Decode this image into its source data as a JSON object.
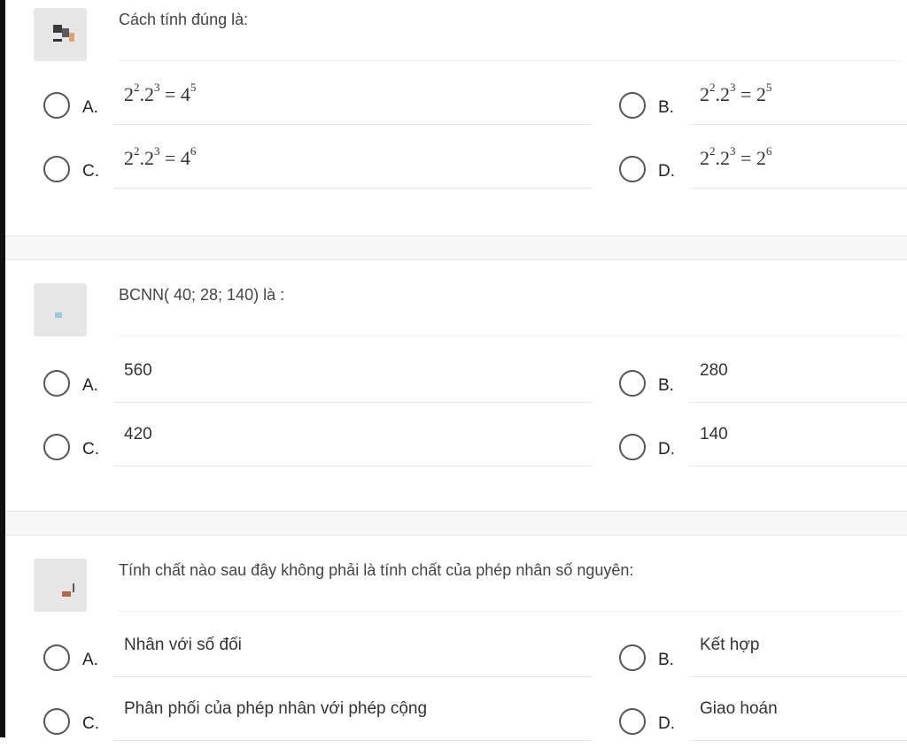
{
  "questions": [
    {
      "text": "Cách tính đúng là:",
      "options": [
        {
          "letter": "A.",
          "math": [
            {
              "b": "2",
              "e": "2"
            },
            {
              "sep": "."
            },
            {
              "b": "2",
              "e": "3"
            },
            {
              "sep": " = "
            },
            {
              "b": "4",
              "e": "5"
            }
          ]
        },
        {
          "letter": "B.",
          "math": [
            {
              "b": "2",
              "e": "2"
            },
            {
              "sep": "."
            },
            {
              "b": "2",
              "e": "3"
            },
            {
              "sep": " = "
            },
            {
              "b": "2",
              "e": "5"
            }
          ]
        },
        {
          "letter": "C.",
          "math": [
            {
              "b": "2",
              "e": "2"
            },
            {
              "sep": "."
            },
            {
              "b": "2",
              "e": "3"
            },
            {
              "sep": " = "
            },
            {
              "b": "4",
              "e": "6"
            }
          ]
        },
        {
          "letter": "D.",
          "math": [
            {
              "b": "2",
              "e": "2"
            },
            {
              "sep": "."
            },
            {
              "b": "2",
              "e": "3"
            },
            {
              "sep": " = "
            },
            {
              "b": "2",
              "e": "6"
            }
          ]
        }
      ]
    },
    {
      "text": "BCNN( 40; 28; 140) là :",
      "options": [
        {
          "letter": "A.",
          "text": "560"
        },
        {
          "letter": "B.",
          "text": "280"
        },
        {
          "letter": "C.",
          "text": "420"
        },
        {
          "letter": "D.",
          "text": "140"
        }
      ]
    },
    {
      "text": "Tính chất nào sau đây không phải là tính chất của phép nhân số nguyên:",
      "options": [
        {
          "letter": "A.",
          "text": "Nhân với số đối"
        },
        {
          "letter": "B.",
          "text": "Kết hợp"
        },
        {
          "letter": "C.",
          "text": "Phân phối của phép nhân với phép cộng"
        },
        {
          "letter": "D.",
          "text": "Giao hoán"
        }
      ]
    }
  ]
}
